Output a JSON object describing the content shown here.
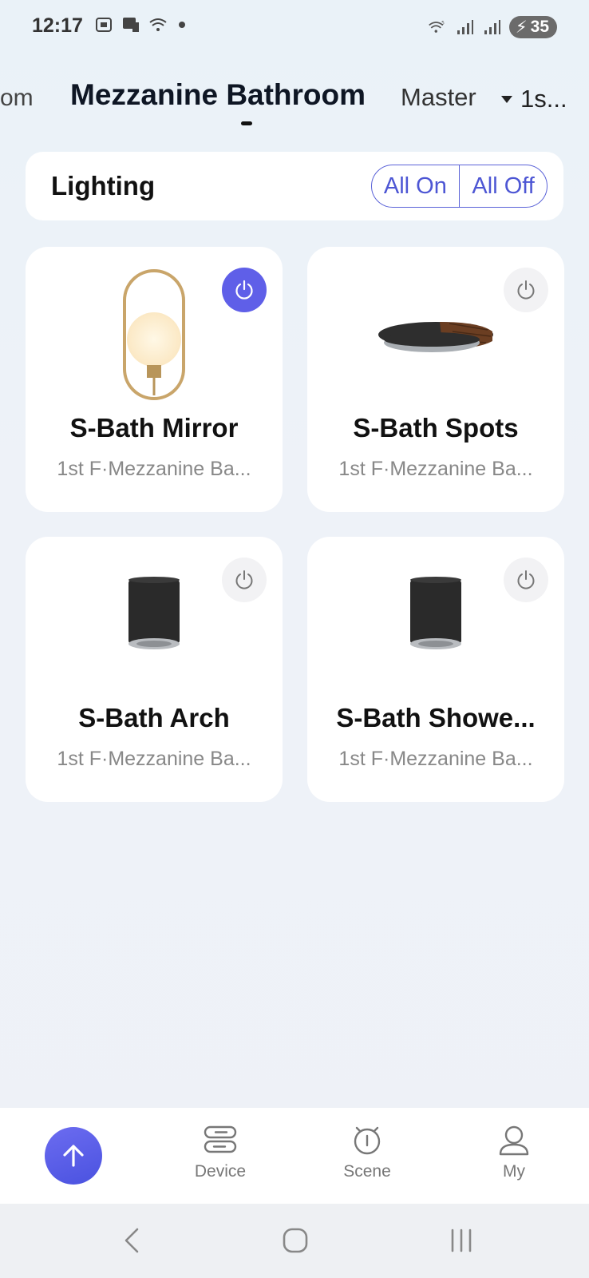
{
  "status_bar": {
    "time": "12:17",
    "battery": "35",
    "icons_left": [
      "screenshot-icon",
      "cast-icon",
      "wifi-icon",
      "dot-icon"
    ],
    "icons_right": [
      "wifi-5-icon",
      "signal-icon",
      "signal-icon",
      "battery-charging-icon"
    ]
  },
  "room_tabs": {
    "prev_tab": "om",
    "active_tab": "Mezzanine Bathroom",
    "next_tab": "Master",
    "floor_selector": "1s..."
  },
  "section": {
    "title": "Lighting",
    "all_on": "All On",
    "all_off": "All Off"
  },
  "devices": [
    {
      "name": "S-Bath Mirror",
      "location": "1st F·Mezzanine Ba...",
      "power": "on",
      "image": "oval-wall-lamp"
    },
    {
      "name": "S-Bath Spots",
      "location": "1st F·Mezzanine Ba...",
      "power": "off",
      "image": "ceiling-disc-light"
    },
    {
      "name": "S-Bath Arch",
      "location": "1st F·Mezzanine Ba...",
      "power": "off",
      "image": "cylinder-downlight"
    },
    {
      "name": "S-Bath Showe...",
      "location": "1st F·Mezzanine Ba...",
      "power": "off",
      "image": "cylinder-downlight"
    }
  ],
  "bottom_nav": {
    "items": [
      {
        "label": "",
        "icon": "arrow-up-icon"
      },
      {
        "label": "Device",
        "icon": "device-icon"
      },
      {
        "label": "Scene",
        "icon": "scene-icon"
      },
      {
        "label": "My",
        "icon": "user-icon"
      }
    ]
  },
  "colors": {
    "accent": "#5b5fe6",
    "power_off_bg": "#f2f2f4",
    "text_secondary": "#888888"
  }
}
